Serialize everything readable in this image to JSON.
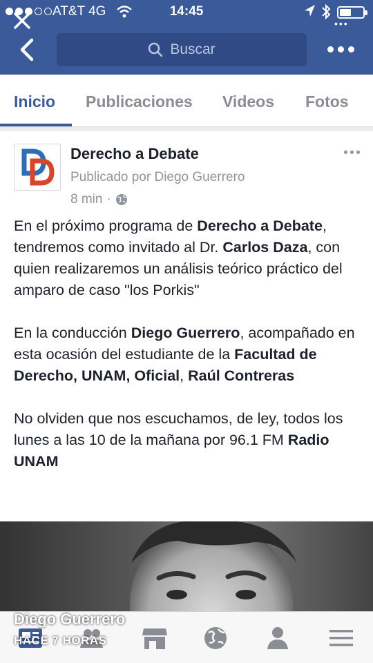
{
  "status_bar": {
    "carrier": "AT&T 4G",
    "time": "14:45"
  },
  "header": {
    "search_placeholder": "Buscar"
  },
  "tabs": [
    {
      "label": "Inicio",
      "active": true
    },
    {
      "label": "Publicaciones",
      "active": false
    },
    {
      "label": "Videos",
      "active": false
    },
    {
      "label": "Fotos",
      "active": false
    }
  ],
  "post": {
    "page_name": "Derecho a Debate",
    "published_by": "Publicado por Diego Guerrero",
    "time": "8 min",
    "privacy_icon": "globe-icon",
    "paragraph1": {
      "t1": "En el próximo programa de ",
      "b1": "Derecho a Debate",
      "t2": ", tendremos como invitado al Dr. ",
      "b2": "Carlos Daza",
      "t3": ", con quien realizaremos un análisis teórico práctico del amparo de caso \"los Porkis\""
    },
    "paragraph2": {
      "t1": "En la conducción ",
      "b1": "Diego Guerrero",
      "t2": ", acompañado en esta ocasión del estudiante de la ",
      "b2": "Facultad de Derecho, UNAM, Oficial",
      "t3": ", ",
      "b3": "Raúl Contreras"
    },
    "paragraph3": {
      "t1": "No olviden que nos escuchamos, de ley, todos los lunes a las 10 de la mañana por 96.1 FM ",
      "b1": "Radio UNAM"
    }
  },
  "overlay": {
    "name": "Diego Guerrero",
    "time": "HACE 7 HORAS"
  },
  "toolbar": {
    "icons": [
      "news-feed-icon",
      "friends-icon",
      "marketplace-icon",
      "globe-icon",
      "profile-icon",
      "menu-icon"
    ]
  },
  "colors": {
    "brand": "#3b5a99",
    "search_bg": "#2f4a85",
    "logo_blue": "#2f6db5",
    "logo_red": "#d9452b"
  }
}
